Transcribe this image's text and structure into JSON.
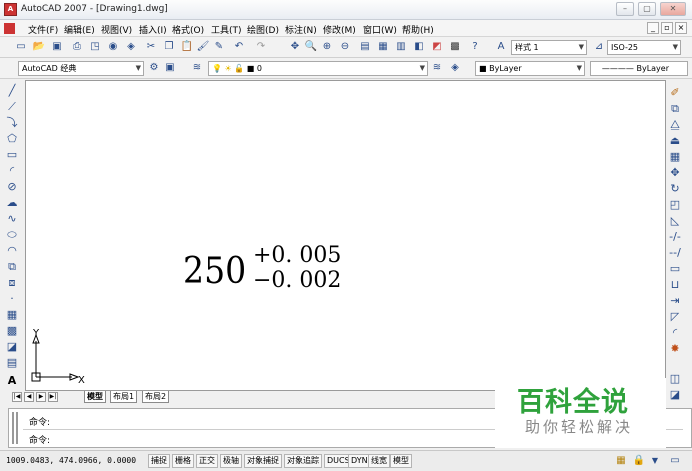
{
  "window": {
    "title": "AutoCAD 2007 - [Drawing1.dwg]",
    "icon_text": "A",
    "controls": [
      "–",
      "▢",
      "✕"
    ],
    "doc_controls": [
      "_",
      "▫",
      "×"
    ]
  },
  "menu": [
    "文件(F)",
    "编辑(E)",
    "视图(V)",
    "插入(I)",
    "格式(O)",
    "工具(T)",
    "绘图(D)",
    "标注(N)",
    "修改(M)",
    "窗口(W)",
    "帮助(H)"
  ],
  "toolbar": {
    "text_style": "样式 1",
    "dim_style": "ISO-25",
    "workspace": "AutoCAD 经典",
    "layer": "0",
    "color": "ByLayer",
    "linetype": "ByLayer"
  },
  "drawing": {
    "dimension_base": "250",
    "upper_tolerance": "+0. 005",
    "lower_tolerance": "−0. 002",
    "ucs_y": "Y",
    "ucs_x": "X"
  },
  "layout_tabs": [
    "模型",
    "布局1",
    "布局2"
  ],
  "command": {
    "line1": "命令:",
    "line2": "命令:"
  },
  "watermark": {
    "main": "百科全说",
    "sub": "助你轻松解决"
  },
  "status": {
    "coordinates": "1009.0483, 474.0966, 0.0000",
    "buttons": [
      "捕捉",
      "栅格",
      "正交",
      "极轴",
      "对象捕捉",
      "对象追踪",
      "DUCS",
      "DYN",
      "线宽",
      "模型"
    ]
  },
  "colors": {
    "watermark_green": "#2fa23c",
    "icon_blue": "#2a4d8a"
  }
}
